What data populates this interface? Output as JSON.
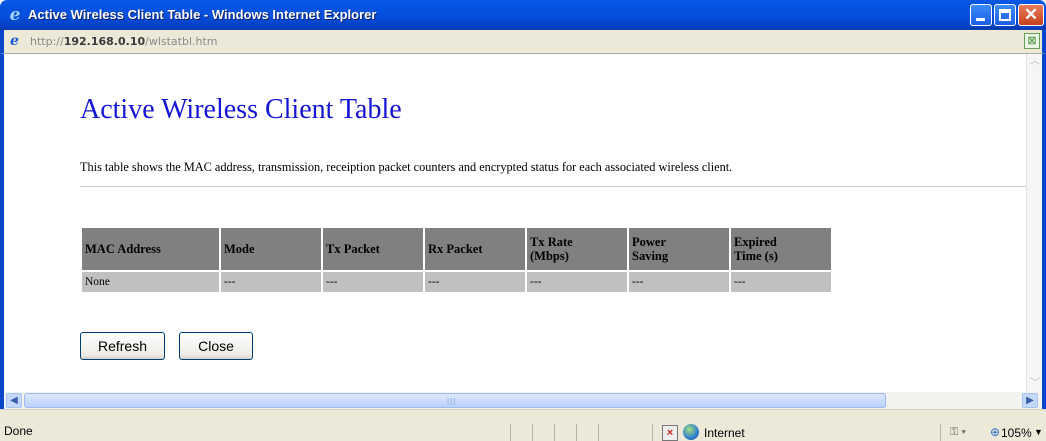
{
  "window": {
    "title": "Active Wireless Client Table - Windows Internet Explorer",
    "url_prefix": "http://",
    "url_host": "192.168.0.10",
    "url_path": "/wlstatbl.htm"
  },
  "page": {
    "heading": "Active Wireless Client Table",
    "description": "This table shows the MAC address, transmission, receiption packet counters and encrypted status for each associated wireless client."
  },
  "table": {
    "headers": [
      {
        "line1": "MAC Address",
        "line2": ""
      },
      {
        "line1": "Mode",
        "line2": ""
      },
      {
        "line1": "Tx Packet",
        "line2": ""
      },
      {
        "line1": "Rx Packet",
        "line2": ""
      },
      {
        "line1": "Tx Rate",
        "line2": "(Mbps)"
      },
      {
        "line1": "Power",
        "line2": "Saving"
      },
      {
        "line1": "Expired",
        "line2": "Time (s)"
      }
    ],
    "rows": [
      [
        "None",
        "---",
        "---",
        "---",
        "---",
        "---",
        "---"
      ]
    ]
  },
  "buttons": {
    "refresh": "Refresh",
    "close": "Close"
  },
  "status": {
    "text": "Done",
    "zone": "Internet",
    "zoom": "105%"
  },
  "colors": {
    "title_bar": "#0554e3",
    "heading": "#1515d6",
    "table_header": "#808080",
    "table_cell": "#c0c0c0"
  }
}
